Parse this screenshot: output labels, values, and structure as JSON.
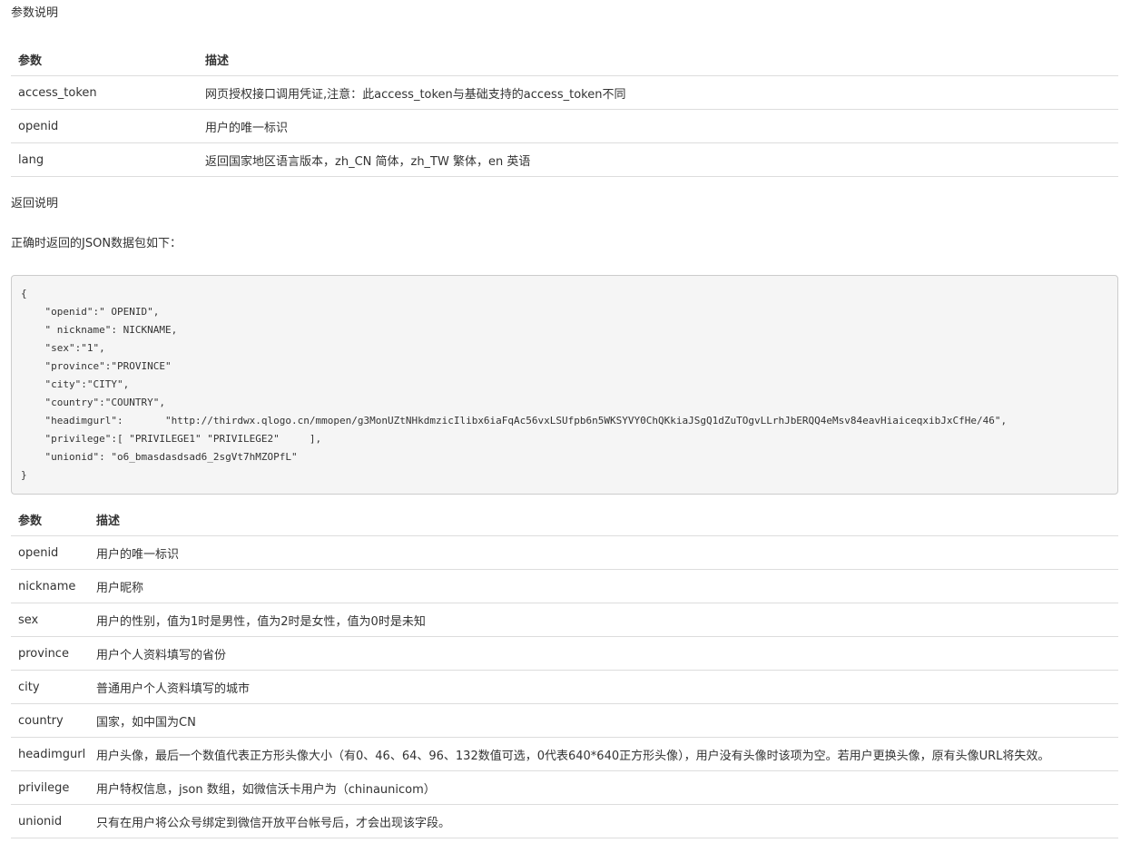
{
  "sections": {
    "params_title": "参数说明",
    "return_title": "返回说明",
    "json_intro": "正确时返回的JSON数据包如下："
  },
  "params_table": {
    "headers": [
      "参数",
      "描述"
    ],
    "rows": [
      [
        "access_token",
        "网页授权接口调用凭证,注意：此access_token与基础支持的access_token不同"
      ],
      [
        "openid",
        "用户的唯一标识"
      ],
      [
        "lang",
        "返回国家地区语言版本，zh_CN 简体，zh_TW 繁体，en 英语"
      ]
    ]
  },
  "json_example": {
    "lines": [
      "{",
      "    \"openid\":\" OPENID\",",
      "    \" nickname\": NICKNAME,",
      "    \"sex\":\"1\",",
      "    \"province\":\"PROVINCE\"",
      "    \"city\":\"CITY\",",
      "    \"country\":\"COUNTRY\",",
      "    \"headimgurl\":       \"http://thirdwx.qlogo.cn/mmopen/g3MonUZtNHkdmzicIlibx6iaFqAc56vxLSUfpb6n5WKSYVY0ChQKkiaJSgQ1dZuTOgvLLrhJbERQQ4eMsv84eavHiaiceqxibJxCfHe/46\",",
      "    \"privilege\":[ \"PRIVILEGE1\" \"PRIVILEGE2\"     ],",
      "    \"unionid\": \"o6_bmasdasdsad6_2sgVt7hMZOPfL\"",
      "}"
    ]
  },
  "fields_table": {
    "headers": [
      "参数",
      "描述"
    ],
    "rows": [
      [
        "openid",
        "用户的唯一标识"
      ],
      [
        "nickname",
        "用户昵称"
      ],
      [
        "sex",
        "用户的性别，值为1时是男性，值为2时是女性，值为0时是未知"
      ],
      [
        "province",
        "用户个人资料填写的省份"
      ],
      [
        "city",
        "普通用户个人资料填写的城市"
      ],
      [
        "country",
        "国家，如中国为CN"
      ],
      [
        "headimgurl",
        "用户头像，最后一个数值代表正方形头像大小（有0、46、64、96、132数值可选，0代表640*640正方形头像），用户没有头像时该项为空。若用户更换头像，原有头像URL将失效。"
      ],
      [
        "privilege",
        "用户特权信息，json 数组，如微信沃卡用户为（chinaunicom）"
      ],
      [
        "unionid",
        "只有在用户将公众号绑定到微信开放平台帐号后，才会出现该字段。"
      ]
    ]
  }
}
